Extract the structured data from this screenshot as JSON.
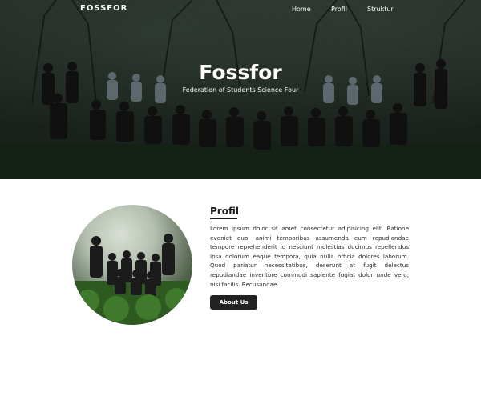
{
  "nav": {
    "brand": "FOSSFOR",
    "links": [
      "Home",
      "Profil",
      "Struktur"
    ]
  },
  "hero": {
    "title": "Fossfor",
    "subtitle": "Federation of Students Science Four"
  },
  "about": {
    "title": "Profil",
    "text": "Lorem ipsum dolor sit amet consectetur adipisicing elit. Ratione eveniet quo, animi temporibus assumenda eum repudiandae tempore reprehenderit id nesciunt molestias ducimus repellendus ipsa dolorum eaque tempora, quia nulla officia dolores laborum. Quod pariatur necessitatibus, deserunt at fugit delectus repudiandae inventore commodi sapiente fugiat dolor unde vero, nisi facilis. Recusandae.",
    "button_label": "About Us"
  },
  "colors": {
    "button_bg": "#222222",
    "hero_overlay": "#2c3a2e",
    "text": "#2a2a2a"
  }
}
